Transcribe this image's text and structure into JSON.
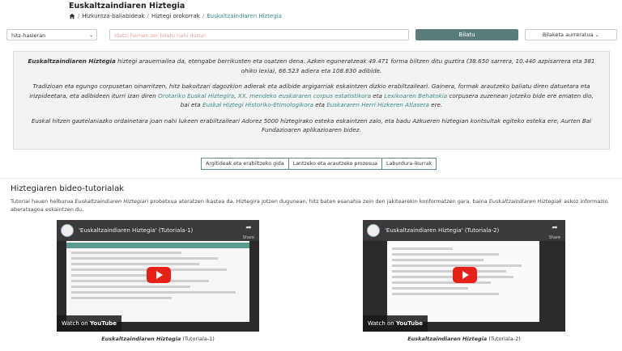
{
  "header": {
    "title": "Euskaltzaindiaren Hiztegia",
    "breadcrumb": [
      "Hizkuntza-baliabideak",
      "Hiztegi orokorrak",
      "Euskaltzaindiaren Hiztegia"
    ]
  },
  "search": {
    "mode": "hitz-hasieran",
    "placeholder": "Idatzi hemen zer bilatu nahi duzun",
    "button": "Bilatu",
    "advanced": "Bilaketa aurreratua"
  },
  "intro": {
    "p1_title": "Euskaltzaindiaren Hiztegia",
    "p1_text": " hiztegi arauemailea da, etengabe berrikusten eta osatzen dena. Azken eguneratzeak 49.471 forma biltzen ditu guztira (38.650 sarrera, 10.440 azpisarrera eta 381 ohiko lexia), 66.523 adiera eta 108.630 adibide.",
    "p2_a": "Tradizioan eta egungo corpusetan oinarritzen, hitz bakoitzari dagozkion adierak eta adibide argigarriak eskaintzen dizkio erabiltzaileari. Gainera, formak arautzeko baliatu diren datuetara eta irizpideetara, eta adibideen iturri izan diren ",
    "link1": "Orotariko Euskal Hiztegira",
    "p2_b": ", ",
    "link2": "XX. mendeko euskararen corpus estatistikora",
    "p2_c": " eta ",
    "link3": "Lexikoaren Behatokia",
    "p2_d": " corpusera zuzenean jotzeko bide ere ematen dio, bai eta ",
    "link4": "Euskal Hiztegi Historiko-Etimologikora",
    "p2_e": " eta ",
    "link5": "Euskararen Herri Hizkeren Atlasera",
    "p2_f": " ere.",
    "p3": "Euskal hitzen gaztelaniazko ordainetara joan nahi lukeen erabiltzaileari Adorez 5000 hiztegirako esteka eskaintzen zaio, eta badu Azkueren hiztegian kontsultak egiteko esteka ere, Aurten Bai Fundazioaren aplikazioaren bidez."
  },
  "guides": [
    "Argitideak eta erabiltzeko gida",
    "Lantzeko eta arautzeko prozesua",
    "Laburdura-ikurrak"
  ],
  "tutorials": {
    "title": "Hiztegiaren bideo-tutorialak",
    "desc_a": "Tutorial hauen helburua ",
    "desc_em1": "Euskaltzaindiaren Hiztegia",
    "desc_b": "ri probetxua ateratzen ikastea da. Hiztegira jotzen dugunean, hitz baten esanahia zein den jakitearekin konformatzen gara, baina ",
    "desc_em2": "Euskaltzaindiaren Hiztegiak",
    "desc_c": " askoz informazio aberatsagoa eskaintzen du.",
    "videos": [
      {
        "title": "'Euskaltzaindiaren Hiztegia' (Tutoriala-1)",
        "watch": "Watch on",
        "yt": "YouTube",
        "share": "Share",
        "caption_em": "Euskaltzaindiaren Hiztegia",
        "caption_rest": " (Tutoriala-1)"
      },
      {
        "title": "'Euskaltzaindiaren Hiztegia' (Tutoriala-2)",
        "watch": "Watch on",
        "yt": "YouTube",
        "share": "Share",
        "caption_em": "Euskaltzaindiaren Hiztegia",
        "caption_rest": " (Tutoriala-2)"
      }
    ]
  }
}
